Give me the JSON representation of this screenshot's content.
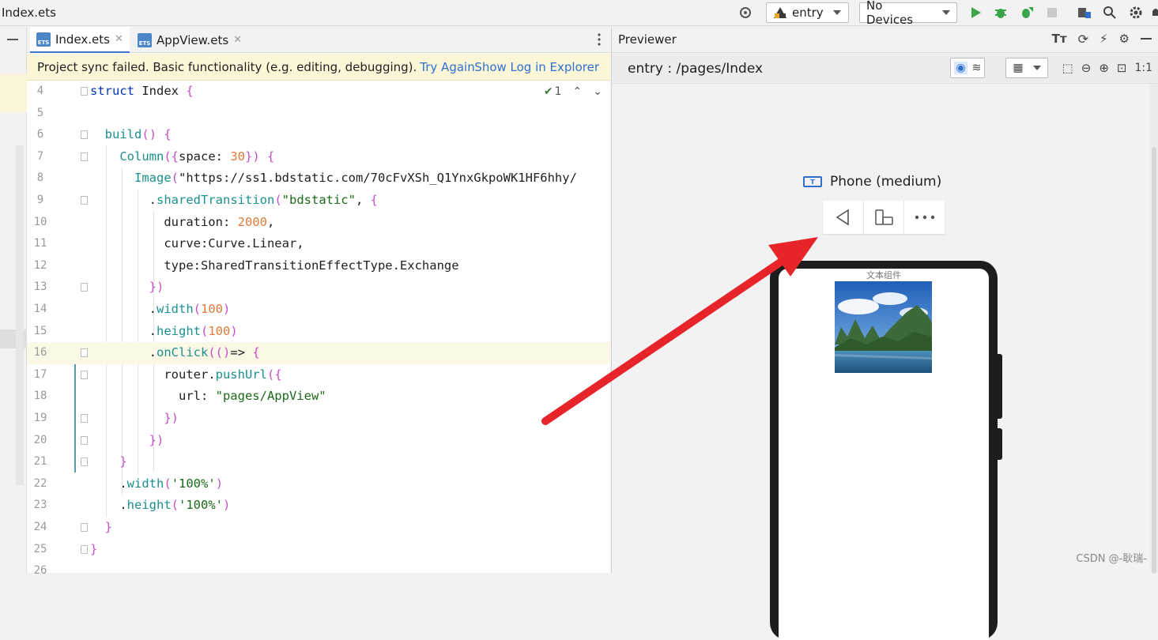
{
  "window": {
    "file_title": "Index.ets",
    "module_select": "entry",
    "device_select": "No Devices"
  },
  "editor": {
    "tabs": [
      {
        "label": "Index.ets",
        "active": true
      },
      {
        "label": "AppView.ets",
        "active": false
      }
    ],
    "banner": {
      "message": "Project sync failed. Basic functionality (e.g. editing, debugging).",
      "try_again": "Try Again",
      "show_log": "Show Log in Explorer"
    },
    "inspection_count": "1",
    "lines": [
      {
        "num": "4",
        "text": "struct Index {"
      },
      {
        "num": "5",
        "text": ""
      },
      {
        "num": "6",
        "text": "  build() {"
      },
      {
        "num": "7",
        "text": "    Column({space: 30}) {"
      },
      {
        "num": "8",
        "text": "      Image(\"https://ss1.bdstatic.com/70cFvXSh_Q1YnxGkpoWK1HF6hhy/"
      },
      {
        "num": "9",
        "text": "        .sharedTransition(\"bdstatic\", {"
      },
      {
        "num": "10",
        "text": "          duration: 2000,"
      },
      {
        "num": "11",
        "text": "          curve:Curve.Linear,"
      },
      {
        "num": "12",
        "text": "          type:SharedTransitionEffectType.Exchange"
      },
      {
        "num": "13",
        "text": "        })"
      },
      {
        "num": "14",
        "text": "        .width(100)"
      },
      {
        "num": "15",
        "text": "        .height(100)"
      },
      {
        "num": "16",
        "text": "        .onClick(()=> {"
      },
      {
        "num": "17",
        "text": "          router.pushUrl({"
      },
      {
        "num": "18",
        "text": "            url: \"pages/AppView\""
      },
      {
        "num": "19",
        "text": "          })"
      },
      {
        "num": "20",
        "text": "        })"
      },
      {
        "num": "21",
        "text": "    }"
      },
      {
        "num": "22",
        "text": "    .width('100%')"
      },
      {
        "num": "23",
        "text": "    .height('100%')"
      },
      {
        "num": "24",
        "text": "  }"
      },
      {
        "num": "25",
        "text": "}"
      },
      {
        "num": "26",
        "text": ""
      }
    ]
  },
  "previewer": {
    "title": "Previewer",
    "page_path": "entry : /pages/Index",
    "device_name": "Phone (medium)",
    "zoom_label": "1:1",
    "screen_text": "文本组件"
  },
  "watermark": "CSDN @-耿瑞-",
  "colors": {
    "accent": "#2f6fd1",
    "run_green": "#3aa54a",
    "arrow_red": "#e8242b"
  }
}
